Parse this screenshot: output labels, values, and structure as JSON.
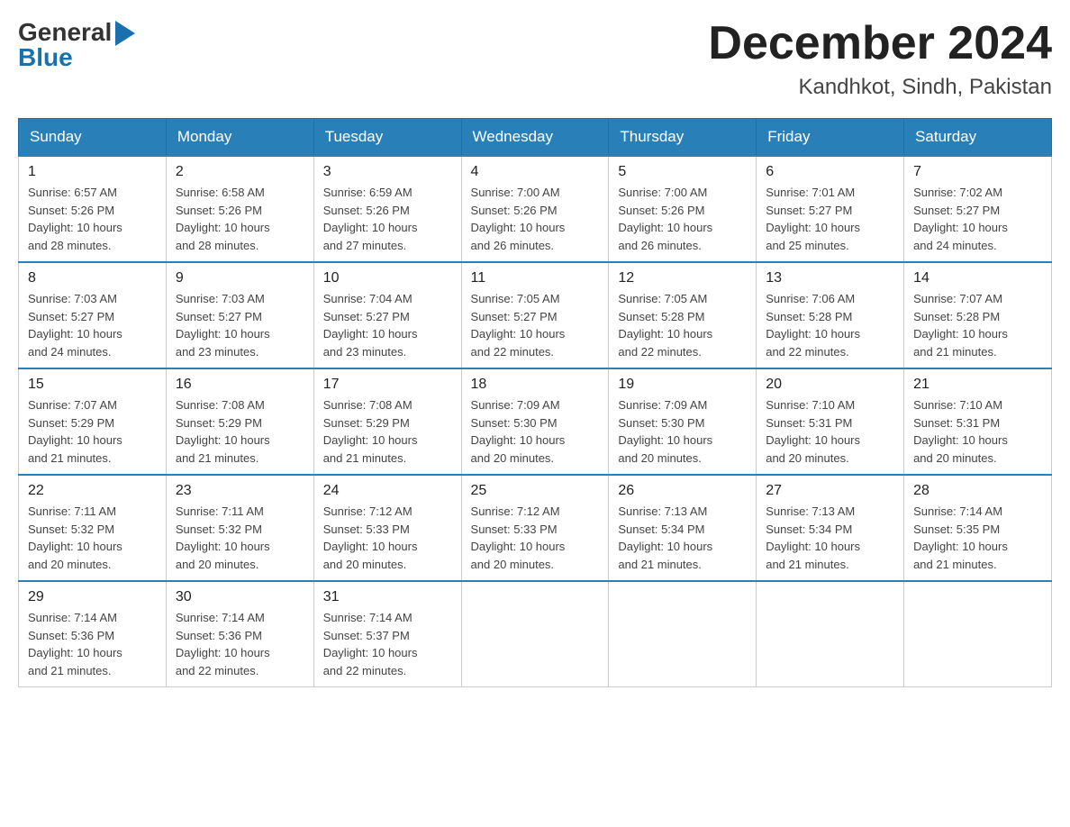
{
  "header": {
    "title": "December 2024",
    "subtitle": "Kandhkot, Sindh, Pakistan",
    "logo_general": "General",
    "logo_blue": "Blue"
  },
  "days_of_week": [
    "Sunday",
    "Monday",
    "Tuesday",
    "Wednesday",
    "Thursday",
    "Friday",
    "Saturday"
  ],
  "weeks": [
    [
      {
        "day": "1",
        "sunrise": "6:57 AM",
        "sunset": "5:26 PM",
        "daylight": "10 hours and 28 minutes."
      },
      {
        "day": "2",
        "sunrise": "6:58 AM",
        "sunset": "5:26 PM",
        "daylight": "10 hours and 28 minutes."
      },
      {
        "day": "3",
        "sunrise": "6:59 AM",
        "sunset": "5:26 PM",
        "daylight": "10 hours and 27 minutes."
      },
      {
        "day": "4",
        "sunrise": "7:00 AM",
        "sunset": "5:26 PM",
        "daylight": "10 hours and 26 minutes."
      },
      {
        "day": "5",
        "sunrise": "7:00 AM",
        "sunset": "5:26 PM",
        "daylight": "10 hours and 26 minutes."
      },
      {
        "day": "6",
        "sunrise": "7:01 AM",
        "sunset": "5:27 PM",
        "daylight": "10 hours and 25 minutes."
      },
      {
        "day": "7",
        "sunrise": "7:02 AM",
        "sunset": "5:27 PM",
        "daylight": "10 hours and 24 minutes."
      }
    ],
    [
      {
        "day": "8",
        "sunrise": "7:03 AM",
        "sunset": "5:27 PM",
        "daylight": "10 hours and 24 minutes."
      },
      {
        "day": "9",
        "sunrise": "7:03 AM",
        "sunset": "5:27 PM",
        "daylight": "10 hours and 23 minutes."
      },
      {
        "day": "10",
        "sunrise": "7:04 AM",
        "sunset": "5:27 PM",
        "daylight": "10 hours and 23 minutes."
      },
      {
        "day": "11",
        "sunrise": "7:05 AM",
        "sunset": "5:27 PM",
        "daylight": "10 hours and 22 minutes."
      },
      {
        "day": "12",
        "sunrise": "7:05 AM",
        "sunset": "5:28 PM",
        "daylight": "10 hours and 22 minutes."
      },
      {
        "day": "13",
        "sunrise": "7:06 AM",
        "sunset": "5:28 PM",
        "daylight": "10 hours and 22 minutes."
      },
      {
        "day": "14",
        "sunrise": "7:07 AM",
        "sunset": "5:28 PM",
        "daylight": "10 hours and 21 minutes."
      }
    ],
    [
      {
        "day": "15",
        "sunrise": "7:07 AM",
        "sunset": "5:29 PM",
        "daylight": "10 hours and 21 minutes."
      },
      {
        "day": "16",
        "sunrise": "7:08 AM",
        "sunset": "5:29 PM",
        "daylight": "10 hours and 21 minutes."
      },
      {
        "day": "17",
        "sunrise": "7:08 AM",
        "sunset": "5:29 PM",
        "daylight": "10 hours and 21 minutes."
      },
      {
        "day": "18",
        "sunrise": "7:09 AM",
        "sunset": "5:30 PM",
        "daylight": "10 hours and 20 minutes."
      },
      {
        "day": "19",
        "sunrise": "7:09 AM",
        "sunset": "5:30 PM",
        "daylight": "10 hours and 20 minutes."
      },
      {
        "day": "20",
        "sunrise": "7:10 AM",
        "sunset": "5:31 PM",
        "daylight": "10 hours and 20 minutes."
      },
      {
        "day": "21",
        "sunrise": "7:10 AM",
        "sunset": "5:31 PM",
        "daylight": "10 hours and 20 minutes."
      }
    ],
    [
      {
        "day": "22",
        "sunrise": "7:11 AM",
        "sunset": "5:32 PM",
        "daylight": "10 hours and 20 minutes."
      },
      {
        "day": "23",
        "sunrise": "7:11 AM",
        "sunset": "5:32 PM",
        "daylight": "10 hours and 20 minutes."
      },
      {
        "day": "24",
        "sunrise": "7:12 AM",
        "sunset": "5:33 PM",
        "daylight": "10 hours and 20 minutes."
      },
      {
        "day": "25",
        "sunrise": "7:12 AM",
        "sunset": "5:33 PM",
        "daylight": "10 hours and 20 minutes."
      },
      {
        "day": "26",
        "sunrise": "7:13 AM",
        "sunset": "5:34 PM",
        "daylight": "10 hours and 21 minutes."
      },
      {
        "day": "27",
        "sunrise": "7:13 AM",
        "sunset": "5:34 PM",
        "daylight": "10 hours and 21 minutes."
      },
      {
        "day": "28",
        "sunrise": "7:14 AM",
        "sunset": "5:35 PM",
        "daylight": "10 hours and 21 minutes."
      }
    ],
    [
      {
        "day": "29",
        "sunrise": "7:14 AM",
        "sunset": "5:36 PM",
        "daylight": "10 hours and 21 minutes."
      },
      {
        "day": "30",
        "sunrise": "7:14 AM",
        "sunset": "5:36 PM",
        "daylight": "10 hours and 22 minutes."
      },
      {
        "day": "31",
        "sunrise": "7:14 AM",
        "sunset": "5:37 PM",
        "daylight": "10 hours and 22 minutes."
      },
      null,
      null,
      null,
      null
    ]
  ],
  "labels": {
    "sunrise": "Sunrise:",
    "sunset": "Sunset:",
    "daylight": "Daylight:"
  }
}
